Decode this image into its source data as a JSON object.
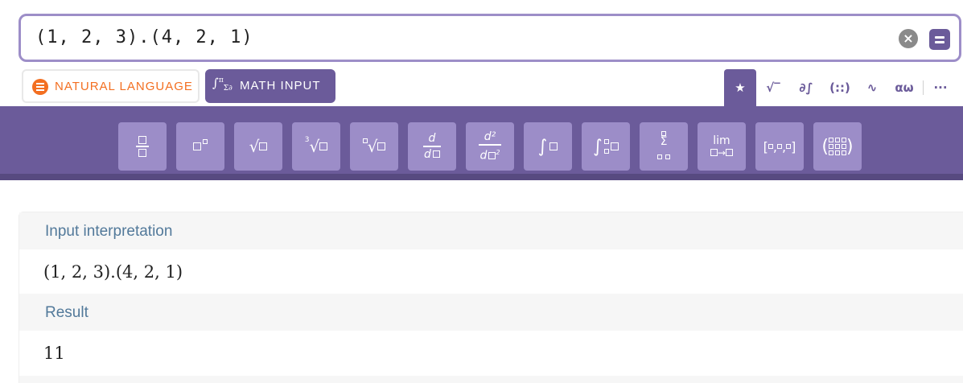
{
  "input": {
    "value": "(1, 2, 3).(4, 2, 1)",
    "clear_icon": "clear-icon",
    "compute_icon": "equals-icon"
  },
  "modes": {
    "natural_language": "NATURAL LANGUAGE",
    "math_input": "MATH INPUT"
  },
  "tabs": [
    {
      "name": "favorites",
      "glyph": "★"
    },
    {
      "name": "algebra",
      "glyph": "√‾"
    },
    {
      "name": "calculus",
      "glyph": "∂∫"
    },
    {
      "name": "matrices",
      "glyph": "(::)"
    },
    {
      "name": "functions",
      "glyph": "∿"
    },
    {
      "name": "greek",
      "glyph": "αω"
    },
    {
      "name": "more",
      "glyph": "···"
    }
  ],
  "toolbar": {
    "buttons": [
      "fraction",
      "superscript",
      "square-root",
      "cube-root",
      "nth-root",
      "derivative",
      "second-derivative",
      "integral",
      "definite-integral",
      "sum",
      "limit",
      "vector",
      "matrix"
    ],
    "labels": {
      "cube_index": "3",
      "d": "d",
      "d_sq": "d²",
      "lim": "lim",
      "sum": "Σ"
    }
  },
  "pods": [
    {
      "title": "Input interpretation",
      "content": "(1, 2, 3).(4, 2, 1)"
    },
    {
      "title": "Result",
      "content": "11"
    }
  ],
  "colors": {
    "brand_purple": "#6b5b9a",
    "button_purple": "#9c8dc8",
    "orange": "#f36f21",
    "pod_title": "#52799a"
  }
}
